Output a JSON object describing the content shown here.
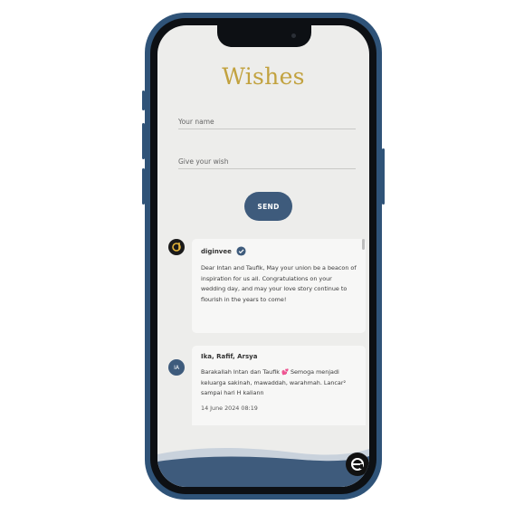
{
  "title": "Wishes",
  "form": {
    "name_placeholder": "Your name",
    "wish_placeholder": "Give your wish",
    "send_label": "SEND"
  },
  "wishes": [
    {
      "avatar": "d",
      "name": "diginvee",
      "verified": true,
      "message": "Dear Intan and Taufik, May your union be a beacon of inspiration for us all. Congratulations on your wedding day, and may your love story continue to flourish in the years to come!"
    },
    {
      "avatar": "IA",
      "name": "Ika, Rafif, Arsya",
      "message": "Barakallah Intan dan Taufik 💕 Semoga menjadi keluarga sakinah, mawaddah, warahmah. Lancar² sampai hari H kaliann",
      "time": "14 June 2024 08:19"
    }
  ],
  "colors": {
    "accent_gold": "#c2a23f",
    "navy": "#3e5b7c"
  },
  "icons": {
    "verified": "check-badge-icon",
    "logo": "e-logo-icon"
  }
}
